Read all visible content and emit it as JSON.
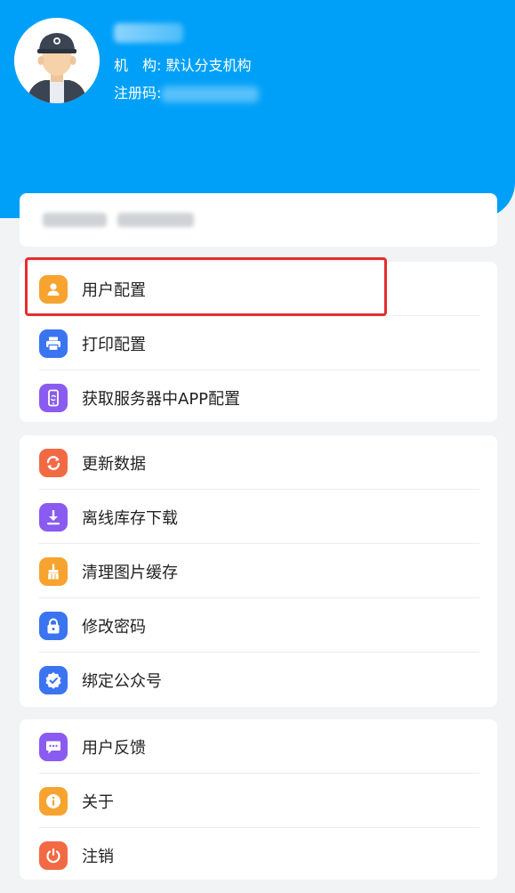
{
  "profile": {
    "org_label": "机　构: 默认分支机构",
    "reg_label": "注册码:"
  },
  "groups": [
    [
      {
        "label": "用户配置",
        "icon": "user-icon",
        "color": "#f7a330"
      },
      {
        "label": "打印配置",
        "icon": "printer-icon",
        "color": "#3b74f0"
      },
      {
        "label": "获取服务器中APP配置",
        "icon": "phone-sync-icon",
        "color": "#8a5bf0"
      }
    ],
    [
      {
        "label": "更新数据",
        "icon": "refresh-icon",
        "color": "#f26a44"
      },
      {
        "label": "离线库存下载",
        "icon": "download-icon",
        "color": "#8a5bf0"
      },
      {
        "label": "清理图片缓存",
        "icon": "broom-icon",
        "color": "#f7a330"
      },
      {
        "label": "修改密码",
        "icon": "lock-icon",
        "color": "#3b74f0"
      },
      {
        "label": "绑定公众号",
        "icon": "verified-badge-icon",
        "color": "#3b74f0"
      }
    ],
    [
      {
        "label": "用户反馈",
        "icon": "chat-bubble-icon",
        "color": "#8a5bf0"
      },
      {
        "label": "关于",
        "icon": "info-icon",
        "color": "#f7a330"
      },
      {
        "label": "注销",
        "icon": "power-icon",
        "color": "#f26a44"
      }
    ]
  ]
}
